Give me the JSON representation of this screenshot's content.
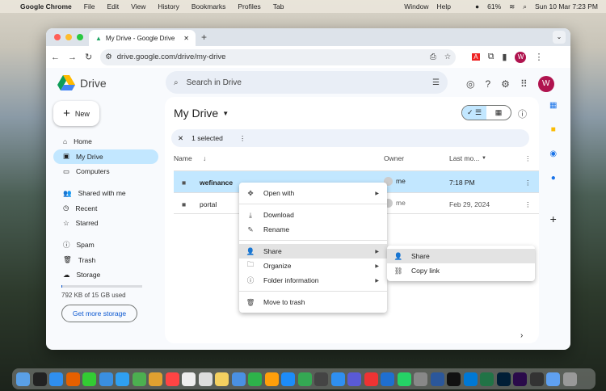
{
  "menubar": {
    "app": "Google Chrome",
    "items": [
      "File",
      "Edit",
      "View",
      "History",
      "Bookmarks",
      "Profiles",
      "Tab"
    ],
    "right_items": [
      "Window",
      "Help"
    ],
    "battery": "61%",
    "datetime": "Sun 10 Mar  7:23 PM"
  },
  "browser": {
    "tab_title": "My Drive - Google Drive",
    "url": "drive.google.com/drive/my-drive",
    "profile_initial": "W"
  },
  "drive": {
    "logo_text": "Drive",
    "search_placeholder": "Search in Drive",
    "avatar": "W",
    "new_label": "New",
    "sidebar": [
      {
        "label": "Home",
        "icon": "⌂"
      },
      {
        "label": "My Drive",
        "icon": "▣"
      },
      {
        "label": "Computers",
        "icon": "▭"
      },
      {
        "label": "Shared with me",
        "icon": "👥"
      },
      {
        "label": "Recent",
        "icon": "◷"
      },
      {
        "label": "Starred",
        "icon": "☆"
      },
      {
        "label": "Spam",
        "icon": "ⓘ"
      },
      {
        "label": "Trash",
        "icon": "🗑"
      },
      {
        "label": "Storage",
        "icon": "☁"
      }
    ],
    "storage_text": "792 KB of 15 GB used",
    "storage_fraction": 0.0001,
    "get_more": "Get more storage",
    "title": "My Drive",
    "selected": "1 selected",
    "columns": {
      "name": "Name",
      "owner": "Owner",
      "modified": "Last mo..."
    },
    "rows": [
      {
        "name": "wefinance",
        "owner": "me",
        "modified": "7:18 PM"
      },
      {
        "name": "portal",
        "owner": "me",
        "modified": "Feb 29, 2024"
      }
    ],
    "context_menu": [
      {
        "label": "Open with",
        "icon": "✥"
      },
      {
        "label": "Download",
        "icon": "⤓"
      },
      {
        "label": "Rename",
        "icon": "✎"
      },
      {
        "label": "Share",
        "icon": "👤"
      },
      {
        "label": "Organize",
        "icon": "🗀"
      },
      {
        "label": "Folder information",
        "icon": "ⓘ"
      },
      {
        "label": "Move to trash",
        "icon": "🗑"
      }
    ],
    "submenu": [
      {
        "label": "Share",
        "icon": "👤"
      },
      {
        "label": "Copy link",
        "icon": "⛓"
      }
    ]
  },
  "dock_colors": [
    "#5aa0e6",
    "#222",
    "#2f8ff0",
    "#e66000",
    "#3c3",
    "#3a8fe0",
    "#2f9ff0",
    "#4caf50",
    "#e0a030",
    "#f44",
    "#eee",
    "#ddd",
    "#f4d060",
    "#4a90e2",
    "#2db34a",
    "#ff9f0a",
    "#1d8cf8",
    "#34a853",
    "#444",
    "#2f8ff0",
    "#5a5ad6",
    "#e33",
    "#1f6fd0",
    "#25d366",
    "#888",
    "#2b579a",
    "#111",
    "#0078d4",
    "#217346",
    "#001e36",
    "#2a0a4a",
    "#333",
    "#5fa0f0",
    "#999"
  ]
}
